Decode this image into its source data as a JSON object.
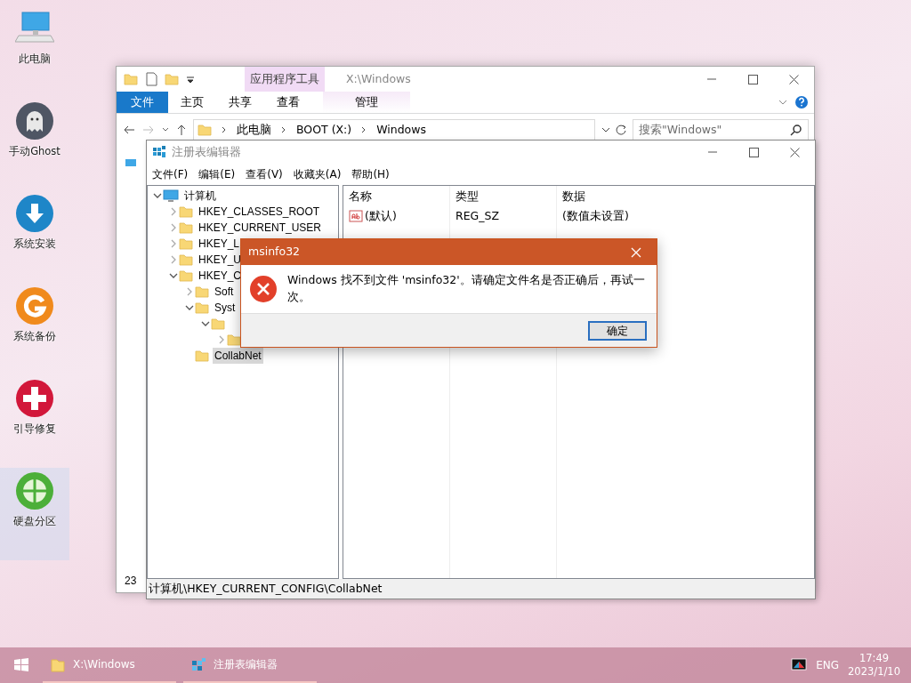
{
  "desktop_icons": [
    {
      "label": "此电脑",
      "kind": "computer",
      "selected": false
    },
    {
      "label": "手动Ghost",
      "kind": "ghost",
      "selected": false
    },
    {
      "label": "系统安装",
      "kind": "install",
      "selected": false
    },
    {
      "label": "系统备份",
      "kind": "backup",
      "selected": false
    },
    {
      "label": "引导修复",
      "kind": "repair",
      "selected": false
    },
    {
      "label": "硬盘分区",
      "kind": "partition",
      "selected": true
    }
  ],
  "explorer": {
    "title": "X:\\Windows",
    "context_group": "应用程序工具",
    "ribbon_tabs": [
      {
        "label": "文件",
        "selected": true
      },
      {
        "label": "主页",
        "selected": false
      },
      {
        "label": "共享",
        "selected": false
      },
      {
        "label": "查看",
        "selected": false
      },
      {
        "label": "管理",
        "selected": false
      }
    ],
    "breadcrumbs": [
      "此电脑",
      "BOOT (X:)",
      "Windows"
    ],
    "search": {
      "placeholder": "搜索\"Windows\""
    },
    "status": "23"
  },
  "regedit": {
    "title": "注册表编辑器",
    "menu": [
      "文件(F)",
      "编辑(E)",
      "查看(V)",
      "收藏夹(A)",
      "帮助(H)"
    ],
    "tree": [
      {
        "label": "计算机",
        "kind": "computer",
        "expanded": true,
        "selected": false,
        "children": [
          {
            "label": "HKEY_CLASSES_ROOT",
            "expanded": false,
            "selected": false
          },
          {
            "label": "HKEY_CURRENT_USER",
            "expanded": false,
            "selected": false
          },
          {
            "label": "HKEY_L",
            "expanded": false,
            "selected": false
          },
          {
            "label": "HKEY_U",
            "expanded": false,
            "selected": false
          },
          {
            "label": "HKEY_C",
            "expanded": true,
            "selected": false,
            "children": [
              {
                "label": "Soft",
                "expanded": false,
                "selected": false
              },
              {
                "label": "Syst",
                "expanded": true,
                "selected": false,
                "children": [
                  {
                    "expanded": true,
                    "children": [
                      {
                        "expanded": false
                      }
                    ]
                  }
                ]
              },
              {
                "label": "CollabNet",
                "selected": true
              }
            ]
          }
        ]
      }
    ],
    "columns": [
      "名称",
      "类型",
      "数据"
    ],
    "rows": [
      [
        "(默认)",
        "REG_SZ",
        "(数值未设置)"
      ]
    ],
    "status": "计算机\\HKEY_CURRENT_CONFIG\\CollabNet"
  },
  "dialog": {
    "title": "msinfo32",
    "message": "Windows 找不到文件 'msinfo32'。请确定文件名是否正确后，再试一次。",
    "button": "确定"
  },
  "taskbar": {
    "items": [
      {
        "label": "X:\\Windows",
        "kind": "folder"
      },
      {
        "label": "注册表编辑器",
        "kind": "regedit"
      }
    ],
    "language": "ENG",
    "time": "17:49",
    "date": "2023/1/10"
  }
}
